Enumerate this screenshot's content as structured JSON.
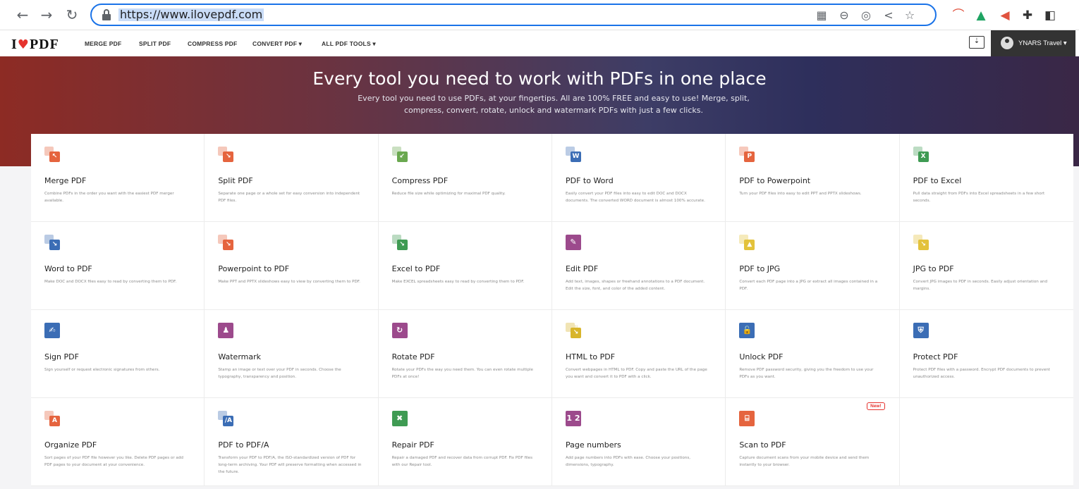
{
  "browser": {
    "url": "https://www.ilovepdf.com"
  },
  "site": {
    "logo_left": "I",
    "logo_right": "PDF",
    "menu": [
      "MERGE PDF",
      "SPLIT PDF",
      "COMPRESS PDF",
      "CONVERT PDF ▾",
      "ALL PDF TOOLS ▾"
    ],
    "user_label": "YNARS Travel ▾"
  },
  "hero": {
    "title": "Every tool you need to work with PDFs in one place",
    "subtitle": "Every tool you need to use PDFs, at your fingertips. All are 100% FREE and easy to use! Merge, split, compress, convert, rotate, unlock and watermark PDFs with just a few clicks."
  },
  "tools": [
    {
      "title": "Merge PDF",
      "desc": "Combine PDFs in the order you want with the easiest PDF merger available.",
      "icon": "merge-icon",
      "color": "#e5643e"
    },
    {
      "title": "Split PDF",
      "desc": "Separate one page or a whole set for easy conversion into independent PDF files.",
      "icon": "split-icon",
      "color": "#e5643e"
    },
    {
      "title": "Compress PDF",
      "desc": "Reduce file size while optimizing for maximal PDF quality.",
      "icon": "compress-icon",
      "color": "#6aa84f"
    },
    {
      "title": "PDF to Word",
      "desc": "Easily convert your PDF files into easy to edit DOC and DOCX documents. The converted WORD document is almost 100% accurate.",
      "icon": "word-icon",
      "color": "#3b6db5"
    },
    {
      "title": "PDF to Powerpoint",
      "desc": "Turn your PDF files into easy to edit PPT and PPTX slideshows.",
      "icon": "powerpoint-icon",
      "color": "#e5643e"
    },
    {
      "title": "PDF to Excel",
      "desc": "Pull data straight from PDFs into Excel spreadsheets in a few short seconds.",
      "icon": "excel-icon",
      "color": "#3f9b53"
    },
    {
      "title": "Word to PDF",
      "desc": "Make DOC and DOCX files easy to read by converting them to PDF.",
      "icon": "word-to-pdf-icon",
      "color": "#3b6db5"
    },
    {
      "title": "Powerpoint to PDF",
      "desc": "Make PPT and PPTX slideshows easy to view by converting them to PDF.",
      "icon": "powerpoint-to-pdf-icon",
      "color": "#e5643e"
    },
    {
      "title": "Excel to PDF",
      "desc": "Make EXCEL spreadsheets easy to read by converting them to PDF.",
      "icon": "excel-to-pdf-icon",
      "color": "#3f9b53"
    },
    {
      "title": "Edit PDF",
      "desc": "Add text, images, shapes or freehand annotations to a PDF document. Edit the size, font, and color of the added content.",
      "icon": "edit-icon",
      "color": "#9c4a8c"
    },
    {
      "title": "PDF to JPG",
      "desc": "Convert each PDF page into a JPG or extract all images contained in a PDF.",
      "icon": "jpg-icon",
      "color": "#e3c23b"
    },
    {
      "title": "JPG to PDF",
      "desc": "Convert JPG images to PDF in seconds. Easily adjust orientation and margins.",
      "icon": "jpg-to-pdf-icon",
      "color": "#e3c23b"
    },
    {
      "title": "Sign PDF",
      "desc": "Sign yourself or request electronic signatures from others.",
      "icon": "sign-icon",
      "color": "#3b6db5"
    },
    {
      "title": "Watermark",
      "desc": "Stamp an image or text over your PDF in seconds. Choose the typography, transparency and position.",
      "icon": "watermark-icon",
      "color": "#9c4a8c"
    },
    {
      "title": "Rotate PDF",
      "desc": "Rotate your PDFs the way you need them. You can even rotate multiple PDFs at once!",
      "icon": "rotate-icon",
      "color": "#9c4a8c"
    },
    {
      "title": "HTML to PDF",
      "desc": "Convert webpages in HTML to PDF. Copy and paste the URL of the page you want and convert it to PDF with a click.",
      "icon": "html-icon",
      "color": "#d8b52b"
    },
    {
      "title": "Unlock PDF",
      "desc": "Remove PDF password security, giving you the freedom to use your PDFs as you want.",
      "icon": "unlock-icon",
      "color": "#3b6db5"
    },
    {
      "title": "Protect PDF",
      "desc": "Protect PDF files with a password. Encrypt PDF documents to prevent unauthorized access.",
      "icon": "protect-icon",
      "color": "#3b6db5"
    },
    {
      "title": "Organize PDF",
      "desc": "Sort pages of your PDF file however you like. Delete PDF pages or add PDF pages to your document at your convenience.",
      "icon": "organize-icon",
      "color": "#e5643e"
    },
    {
      "title": "PDF to PDF/A",
      "desc": "Transform your PDF to PDF/A, the ISO-standardized version of PDF for long-term archiving. Your PDF will preserve formatting when accessed in the future.",
      "icon": "pdfa-icon",
      "color": "#3b6db5"
    },
    {
      "title": "Repair PDF",
      "desc": "Repair a damaged PDF and recover data from corrupt PDF. Fix PDF files with our Repair tool.",
      "icon": "repair-icon",
      "color": "#3f9b53"
    },
    {
      "title": "Page numbers",
      "desc": "Add page numbers into PDFs with ease. Choose your positions, dimensions, typography.",
      "icon": "page-numbers-icon",
      "color": "#9c4a8c"
    },
    {
      "title": "Scan to PDF",
      "desc": "Capture document scans from your mobile device and send them instantly to your browser.",
      "icon": "scan-icon",
      "color": "#e5643e",
      "badge": "New!"
    }
  ]
}
